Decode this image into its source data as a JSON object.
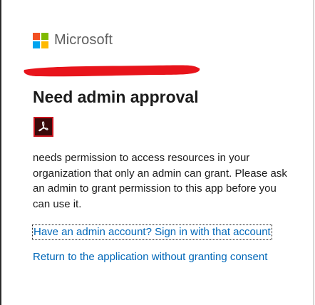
{
  "brand": {
    "name": "Microsoft",
    "logo_colors": [
      "#f25022",
      "#7fba00",
      "#00a4ef",
      "#ffb900"
    ]
  },
  "redaction_color": "#e8141b",
  "title": "Need admin approval",
  "app_icon": {
    "name": "acrobat-icon",
    "border_color": "#c9151e",
    "bg_color": "#3b0a0a"
  },
  "description": "needs permission to access resources in your organization that only an admin can grant. Please ask an admin to grant permission to this app before you can use it.",
  "links": {
    "admin_signin": "Have an admin account? Sign in with that account",
    "return": "Return to the application without granting consent"
  },
  "link_color": "#0067b8"
}
